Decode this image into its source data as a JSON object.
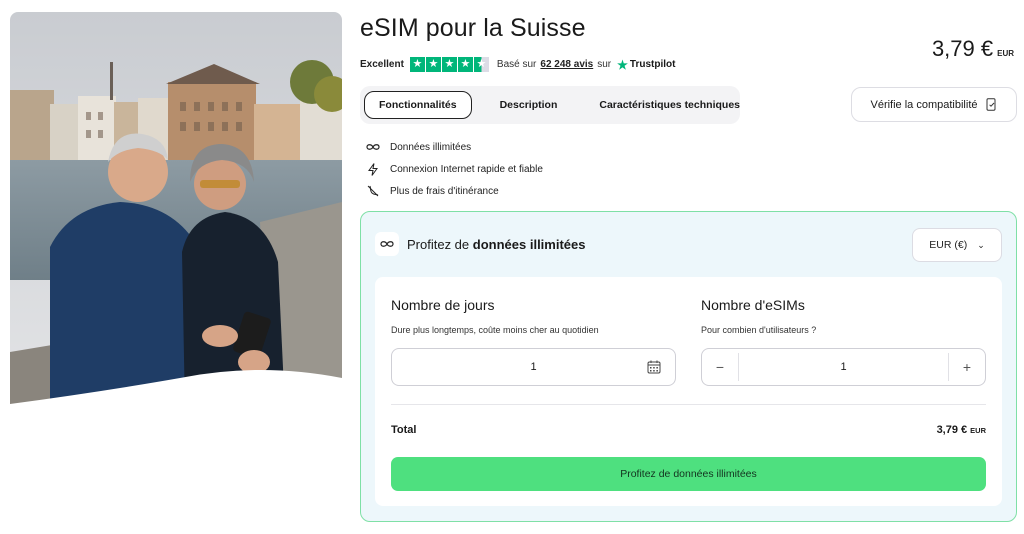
{
  "product": {
    "title": "eSIM pour la Suisse",
    "image_alt": "Couple de seniors consultant un smartphone devant une ville suisse"
  },
  "rating": {
    "label": "Excellent",
    "stars": 4.5,
    "based_prefix": "Basé sur",
    "count": "62 248 avis",
    "based_suffix": "sur",
    "provider": "Trustpilot"
  },
  "price": {
    "amount": "3,79 €",
    "currency": "EUR"
  },
  "tabs": [
    {
      "label": "Fonctionnalités",
      "active": true
    },
    {
      "label": "Description",
      "active": false
    },
    {
      "label": "Caractéristiques techniques",
      "active": false
    }
  ],
  "compat_button": {
    "label": "Vérifie la compatibilité",
    "icon": "phone-check-icon"
  },
  "features": [
    {
      "icon": "infinity-icon",
      "label": "Données illimitées"
    },
    {
      "icon": "bolt-icon",
      "label": "Connexion Internet rapide et fiable"
    },
    {
      "icon": "no-roaming-icon",
      "label": "Plus de frais d'itinérance"
    }
  ],
  "offer": {
    "title_prefix": "Profitez de",
    "title_bold": "données illimitées",
    "currency_select": "EUR (€)",
    "days": {
      "title": "Nombre de jours",
      "subtitle": "Dure plus longtemps, coûte moins cher au quotidien",
      "value": "1"
    },
    "esims": {
      "title": "Nombre d'eSIMs",
      "subtitle": "Pour combien d'utilisateurs ?",
      "value": "1",
      "minus": "−",
      "plus": "+"
    },
    "total_label": "Total",
    "total_amount": "3,79 €",
    "total_currency": "EUR",
    "cta": "Profitez de données illimitées"
  },
  "colors": {
    "accent_green": "#4ee07f",
    "trustpilot_green": "#00b67a",
    "panel_bg": "#edf7fb",
    "panel_border": "#7fe0a6"
  }
}
